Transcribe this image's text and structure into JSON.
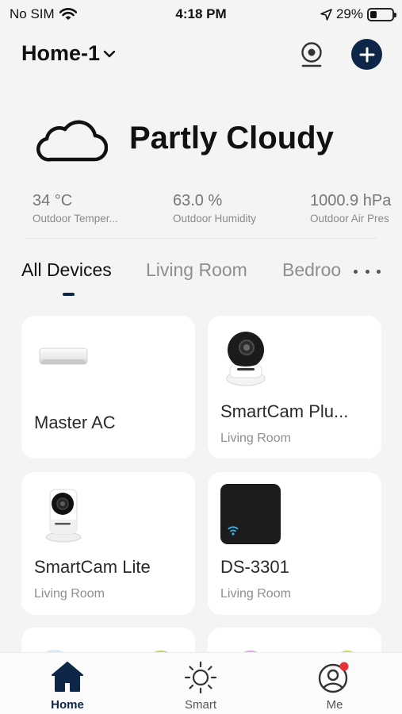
{
  "status_bar": {
    "carrier": "No SIM",
    "time": "4:18 PM",
    "battery_text": "29%",
    "battery_level": 0.29,
    "icons": [
      "wifi-icon",
      "location-arrow-icon",
      "battery-icon"
    ]
  },
  "header": {
    "home_name": "Home-1",
    "icons": [
      "chevron-down-icon",
      "camera-icon",
      "plus-icon"
    ]
  },
  "weather": {
    "condition": "Partly Cloudy",
    "icon": "cloud-icon",
    "stats": [
      {
        "value": "34 °C",
        "label": "Outdoor Temper..."
      },
      {
        "value": "63.0 %",
        "label": "Outdoor Humidity"
      },
      {
        "value": "1000.9 hPa",
        "label": "Outdoor Air Pres"
      }
    ]
  },
  "tabs": [
    {
      "label": "All Devices"
    },
    {
      "label": "Living Room"
    },
    {
      "label": "Bedroo"
    }
  ],
  "devices": [
    {
      "name": "Master AC",
      "room": "",
      "icon": "air-conditioner-icon"
    },
    {
      "name": "SmartCam Plu...",
      "room": "Living Room",
      "icon": "ptz-camera-icon"
    },
    {
      "name": "SmartCam Lite",
      "room": "Living Room",
      "icon": "smart-camera-icon"
    },
    {
      "name": "DS-3301",
      "room": "Living Room",
      "icon": "ir-hub-icon"
    }
  ],
  "bottom_nav": [
    {
      "label": "Home",
      "icon": "home-icon",
      "active": true
    },
    {
      "label": "Smart",
      "icon": "sun-icon",
      "active": false
    },
    {
      "label": "Me",
      "icon": "profile-icon",
      "active": false,
      "badge": true
    }
  ],
  "colors": {
    "accent": "#0e2748",
    "background": "#f4f4f4",
    "card": "#ffffff",
    "badge": "#e8303a",
    "muted_text": "#8f8f8f"
  }
}
